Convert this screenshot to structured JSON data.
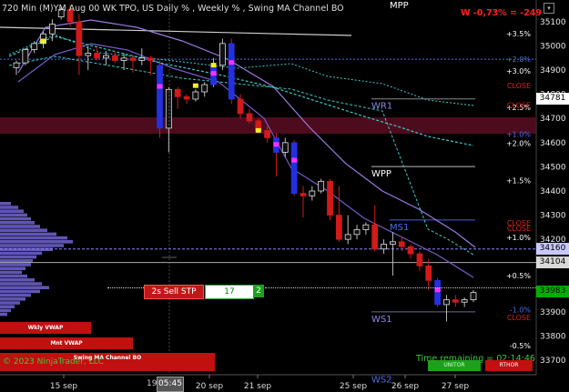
{
  "header": {
    "title": "720 Min (M)YM  Aug 00  WK TPO, US Daily % , Weekly % , Swing MA Channel BO",
    "profit_label": "W -0,73% = -249",
    "mpp_label": "MPP"
  },
  "colors": {
    "background": "#000000",
    "up_candle": "#3a3a3a",
    "down_candle": "#d11a1a",
    "ma_cyan": "#3cc8c8",
    "ma_purple": "#8a6ad8",
    "profile": "#6a5ec8",
    "accent_red": "#e00000"
  },
  "price_axis": {
    "labels": [
      "35100",
      "35000",
      "34900",
      "34800",
      "34700",
      "34600",
      "34500",
      "34400",
      "34300",
      "34200",
      "34100",
      "33900",
      "33800",
      "33700"
    ],
    "range": [
      33640,
      35190
    ]
  },
  "date_axis": {
    "labels": [
      "15 sep",
      "20 sep",
      "21 sep",
      "25 sep",
      "26 sep",
      "27 sep"
    ],
    "cursor_date": "19",
    "cursor_time": "05:45"
  },
  "price_tags": [
    {
      "text": "34781",
      "price": 34781,
      "bg": "#ffffff",
      "fg": "#000000"
    },
    {
      "text": "34160",
      "price": 34160,
      "bg": "#c8c8ff",
      "fg": "#000000"
    },
    {
      "text": "34104",
      "price": 34104,
      "bg": "#d8d8d8",
      "fg": "#000000"
    },
    {
      "text": "33983",
      "price": 33983,
      "bg": "#00b000",
      "fg": "#000000"
    }
  ],
  "pct_labels": [
    {
      "text": "+3.5%",
      "price": 35050,
      "color": "#ffffff"
    },
    {
      "text": "+2.0%",
      "price": 34945,
      "color": "#4a6ee8"
    },
    {
      "text": "+3.0%",
      "price": 34897,
      "color": "#ffffff"
    },
    {
      "text": "CLOSE",
      "price": 34837,
      "color": "#e02020"
    },
    {
      "text": "+2.5%",
      "price": 34746,
      "color": "#ffffff"
    },
    {
      "text": "CLOSE",
      "price": 34755,
      "color": "#e02020"
    },
    {
      "text": "+1.0%",
      "price": 34636,
      "color": "#4a6ee8"
    },
    {
      "text": "+2.0%",
      "price": 34597,
      "color": "#ffffff"
    },
    {
      "text": "+1.5%",
      "price": 34443,
      "color": "#ffffff"
    },
    {
      "text": "CLOSE",
      "price": 34269,
      "color": "#e02020"
    },
    {
      "text": "CLOSE",
      "price": 34246,
      "color": "#e02020"
    },
    {
      "text": "+1.0%",
      "price": 34209,
      "color": "#ffffff"
    },
    {
      "text": "+0.5%",
      "price": 34050,
      "color": "#ffffff"
    },
    {
      "text": "-1.0%",
      "price": 33909,
      "color": "#4a6ee8"
    },
    {
      "text": "CLOSE",
      "price": 33877,
      "color": "#e02020"
    },
    {
      "text": "-0.5%",
      "price": 33760,
      "color": "#ffffff"
    }
  ],
  "levels": [
    {
      "text": "WR1",
      "price": 34781
    },
    {
      "text": "WPP",
      "price": 34501
    },
    {
      "text": "MS1",
      "price": 34280
    },
    {
      "text": "WS1",
      "price": 33900
    },
    {
      "text": "WS2",
      "price": 33650
    }
  ],
  "order": {
    "label": "2s  Sell STP",
    "quantity": "17",
    "stop_value": "2"
  },
  "vwap_buttons": [
    {
      "text": "Wkly VWAP"
    },
    {
      "text": "Mnt VWAP"
    },
    {
      "text": "Swing MA Channel BO"
    }
  ],
  "footer": {
    "copyright": "© 2023 NinjaTrader, LLC",
    "time_remaining": "Time remaining = 02:14:46",
    "btn_green": "UNITOR",
    "btn_red": "RTHOR"
  },
  "chart_data": {
    "type": "candlestick",
    "ylim": [
      33640,
      35190
    ],
    "candles": [
      {
        "o": 34910,
        "h": 34940,
        "l": 34880,
        "c": 34930
      },
      {
        "o": 34930,
        "h": 34990,
        "l": 34920,
        "c": 34985
      },
      {
        "o": 34985,
        "h": 35020,
        "l": 34970,
        "c": 35010
      },
      {
        "o": 35010,
        "h": 35060,
        "l": 34990,
        "c": 35050
      },
      {
        "o": 35050,
        "h": 35110,
        "l": 35020,
        "c": 35090
      },
      {
        "o": 35120,
        "h": 35160,
        "l": 35110,
        "c": 35150
      },
      {
        "o": 35150,
        "h": 35170,
        "l": 35080,
        "c": 35100
      },
      {
        "o": 35100,
        "h": 35130,
        "l": 34880,
        "c": 34960
      },
      {
        "o": 34960,
        "h": 35000,
        "l": 34900,
        "c": 34970
      },
      {
        "o": 34970,
        "h": 34990,
        "l": 34940,
        "c": 34950
      },
      {
        "o": 34950,
        "h": 34980,
        "l": 34920,
        "c": 34960
      },
      {
        "o": 34960,
        "h": 34980,
        "l": 34930,
        "c": 34940
      },
      {
        "o": 34940,
        "h": 34970,
        "l": 34900,
        "c": 34950
      },
      {
        "o": 34950,
        "h": 34960,
        "l": 34890,
        "c": 34940
      },
      {
        "o": 34940,
        "h": 34990,
        "l": 34920,
        "c": 34950
      },
      {
        "o": 34950,
        "h": 34960,
        "l": 34880,
        "c": 34940
      },
      {
        "o": 34920,
        "h": 34940,
        "l": 34620,
        "c": 34660
      },
      {
        "o": 34660,
        "h": 34830,
        "l": 34560,
        "c": 34820
      },
      {
        "o": 34820,
        "h": 34830,
        "l": 34740,
        "c": 34790
      },
      {
        "o": 34790,
        "h": 34800,
        "l": 34760,
        "c": 34780
      },
      {
        "o": 34780,
        "h": 34820,
        "l": 34770,
        "c": 34810
      },
      {
        "o": 34810,
        "h": 34850,
        "l": 34790,
        "c": 34840
      },
      {
        "o": 34840,
        "h": 34950,
        "l": 34830,
        "c": 34920
      },
      {
        "o": 34920,
        "h": 35030,
        "l": 34900,
        "c": 35010
      },
      {
        "o": 35010,
        "h": 35030,
        "l": 34760,
        "c": 34780
      },
      {
        "o": 34780,
        "h": 34800,
        "l": 34700,
        "c": 34720
      },
      {
        "o": 34720,
        "h": 34740,
        "l": 34680,
        "c": 34690
      },
      {
        "o": 34690,
        "h": 34700,
        "l": 34640,
        "c": 34650
      },
      {
        "o": 34650,
        "h": 34670,
        "l": 34600,
        "c": 34620
      },
      {
        "o": 34620,
        "h": 34640,
        "l": 34460,
        "c": 34560
      },
      {
        "o": 34560,
        "h": 34620,
        "l": 34540,
        "c": 34600
      },
      {
        "o": 34600,
        "h": 34610,
        "l": 34380,
        "c": 34390
      },
      {
        "o": 34390,
        "h": 34420,
        "l": 34290,
        "c": 34380
      },
      {
        "o": 34380,
        "h": 34420,
        "l": 34360,
        "c": 34400
      },
      {
        "o": 34400,
        "h": 34450,
        "l": 34390,
        "c": 34440
      },
      {
        "o": 34440,
        "h": 34450,
        "l": 34280,
        "c": 34300
      },
      {
        "o": 34300,
        "h": 34420,
        "l": 34190,
        "c": 34200
      },
      {
        "o": 34200,
        "h": 34300,
        "l": 34180,
        "c": 34220
      },
      {
        "o": 34220,
        "h": 34260,
        "l": 34200,
        "c": 34240
      },
      {
        "o": 34240,
        "h": 34270,
        "l": 34220,
        "c": 34260
      },
      {
        "o": 34260,
        "h": 34340,
        "l": 34150,
        "c": 34160
      },
      {
        "o": 34160,
        "h": 34200,
        "l": 34140,
        "c": 34180
      },
      {
        "o": 34180,
        "h": 34230,
        "l": 34050,
        "c": 34190
      },
      {
        "o": 34190,
        "h": 34210,
        "l": 34150,
        "c": 34170
      },
      {
        "o": 34170,
        "h": 34180,
        "l": 34120,
        "c": 34140
      },
      {
        "o": 34140,
        "h": 34150,
        "l": 34070,
        "c": 34090
      },
      {
        "o": 34090,
        "h": 34120,
        "l": 33990,
        "c": 34030
      },
      {
        "o": 34030,
        "h": 34040,
        "l": 33920,
        "c": 33930
      },
      {
        "o": 33930,
        "h": 33970,
        "l": 33860,
        "c": 33950
      },
      {
        "o": 33950,
        "h": 33970,
        "l": 33920,
        "c": 33940
      },
      {
        "o": 33940,
        "h": 33960,
        "l": 33920,
        "c": 33950
      },
      {
        "o": 33950,
        "h": 33990,
        "l": 33940,
        "c": 33980
      }
    ]
  }
}
